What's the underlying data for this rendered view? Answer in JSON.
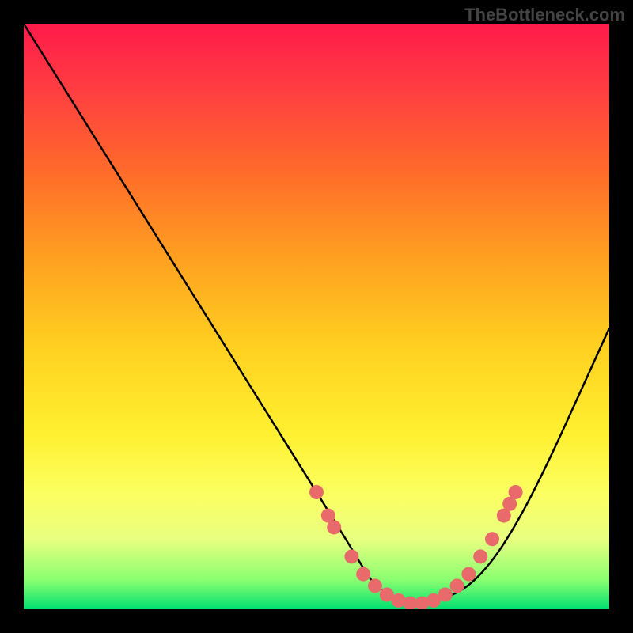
{
  "watermark": "TheBottleneck.com",
  "chart_data": {
    "type": "line",
    "title": "",
    "xlabel": "",
    "ylabel": "",
    "xlim": [
      0,
      100
    ],
    "ylim": [
      0,
      100
    ],
    "series": [
      {
        "name": "curve",
        "x": [
          0,
          5,
          10,
          15,
          20,
          25,
          30,
          35,
          40,
          45,
          50,
          55,
          58,
          60,
          63,
          65,
          68,
          70,
          75,
          80,
          85,
          90,
          95,
          100
        ],
        "y": [
          100,
          92,
          84,
          76,
          68,
          60,
          52,
          44,
          36,
          28,
          20,
          12,
          7,
          4,
          2,
          1.2,
          1,
          1.5,
          3,
          8,
          16,
          26,
          37,
          48
        ]
      }
    ],
    "markers": [
      {
        "x": 50,
        "y": 20
      },
      {
        "x": 52,
        "y": 16
      },
      {
        "x": 53,
        "y": 14
      },
      {
        "x": 56,
        "y": 9
      },
      {
        "x": 58,
        "y": 6
      },
      {
        "x": 60,
        "y": 4
      },
      {
        "x": 62,
        "y": 2.5
      },
      {
        "x": 64,
        "y": 1.5
      },
      {
        "x": 66,
        "y": 1
      },
      {
        "x": 68,
        "y": 1
      },
      {
        "x": 70,
        "y": 1.5
      },
      {
        "x": 72,
        "y": 2.5
      },
      {
        "x": 74,
        "y": 4
      },
      {
        "x": 76,
        "y": 6
      },
      {
        "x": 78,
        "y": 9
      },
      {
        "x": 80,
        "y": 12
      },
      {
        "x": 82,
        "y": 16
      },
      {
        "x": 83,
        "y": 18
      },
      {
        "x": 84,
        "y": 20
      }
    ],
    "marker_color": "#e86a6a",
    "curve_color": "#000000"
  }
}
